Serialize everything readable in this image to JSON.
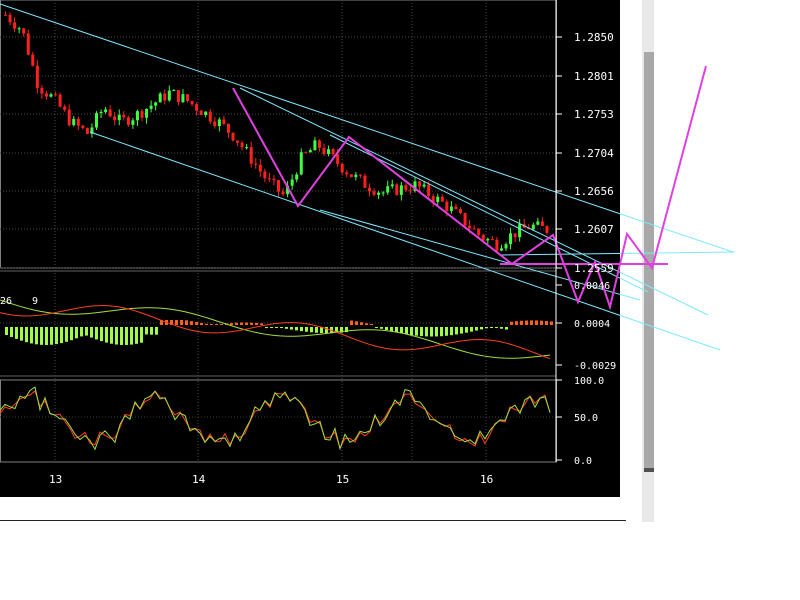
{
  "chart_data": [
    {
      "type": "candlestick",
      "panel": "price",
      "x_ticks": [
        "13",
        "14",
        "15",
        "16"
      ],
      "y_ticks": [
        "1.2850",
        "1.2801",
        "1.2753",
        "1.2704",
        "1.2656",
        "1.2607",
        "1.2559"
      ],
      "ylim": [
        1.2543,
        1.2905
      ],
      "grid": true,
      "colors": {
        "up": "#40ff40",
        "down": "#ff2020",
        "channel": "#7fe8ff",
        "zigzag": "#e040e0"
      },
      "values_close_approx": [
        1.2885,
        1.2865,
        1.279,
        1.277,
        1.274,
        1.2725,
        1.276,
        1.274,
        1.275,
        1.2765,
        1.278,
        1.277,
        1.2755,
        1.274,
        1.272,
        1.269,
        1.266,
        1.264,
        1.269,
        1.271,
        1.269,
        1.267,
        1.2655,
        1.2645,
        1.265,
        1.2655,
        1.264,
        1.2625,
        1.2605,
        1.2585,
        1.2575,
        1.259,
        1.26,
        1.2595
      ]
    },
    {
      "type": "bar",
      "panel": "macd",
      "labels": [
        "26",
        "9"
      ],
      "y_ticks": [
        "0.0046",
        "0.0004",
        "-0.0029"
      ],
      "colors": {
        "histogram_positive": "#ff6020",
        "histogram_negative": "#a0ff40",
        "signal_line": "#a0e040",
        "macd_line": "#ff4020"
      }
    },
    {
      "type": "line",
      "panel": "stochastic",
      "y_ticks": [
        "100.0",
        "50.0",
        "0.0"
      ],
      "ylim": [
        0,
        100
      ],
      "colors": {
        "line_a": "#ff4020",
        "line_b": "#a0e040"
      }
    }
  ]
}
